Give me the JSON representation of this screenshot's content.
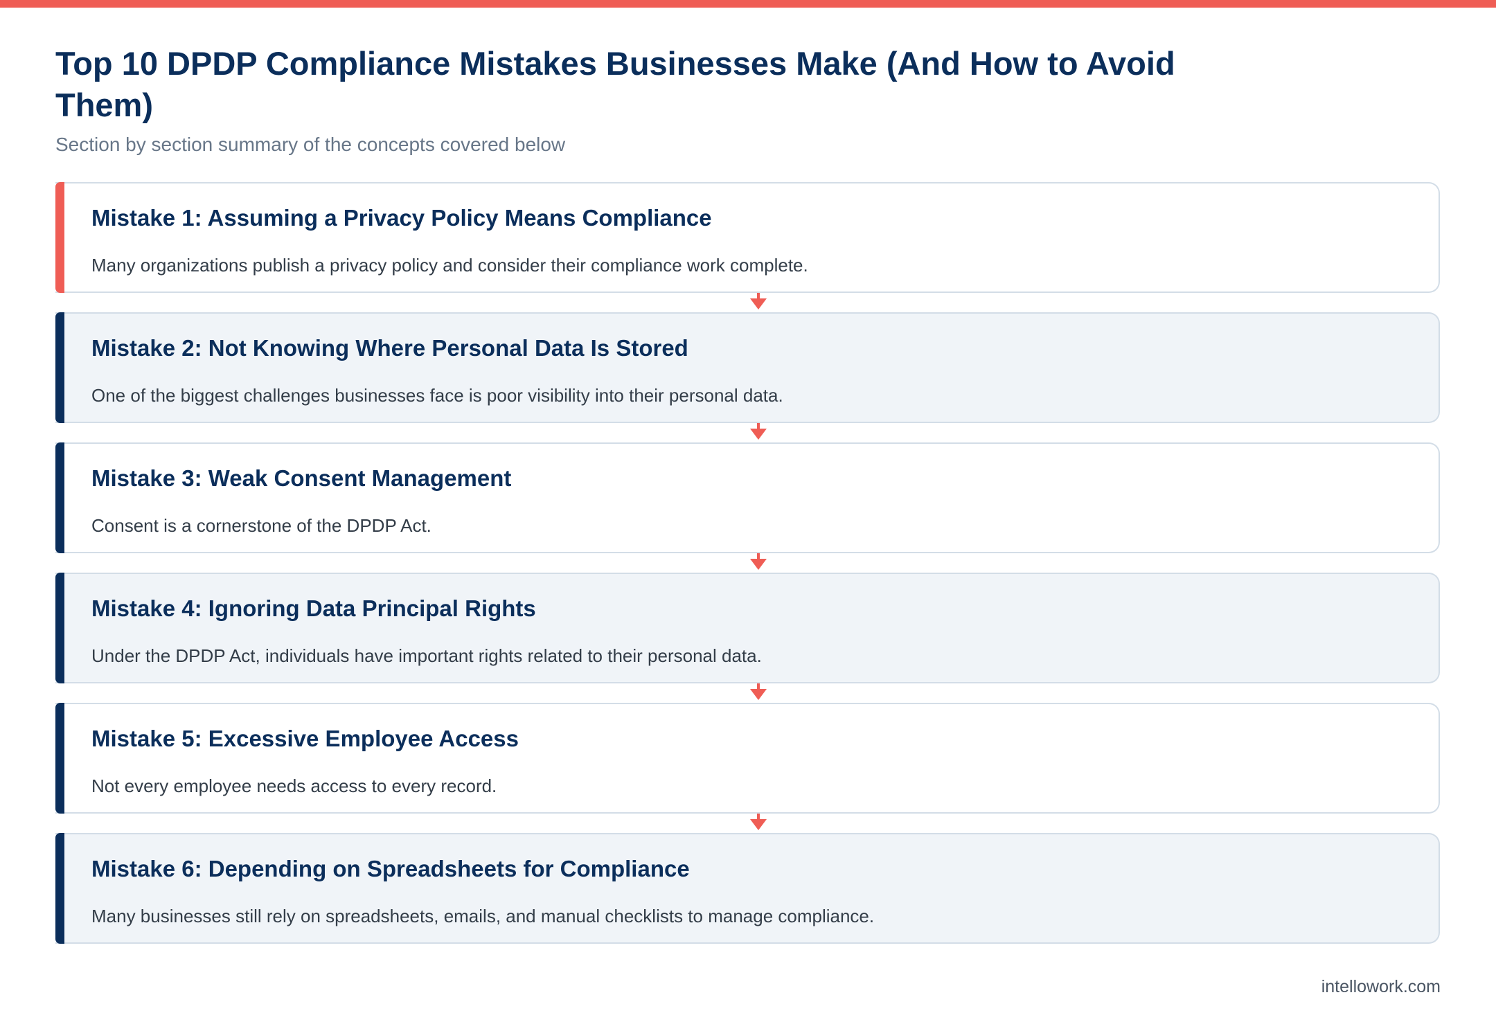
{
  "colors": {
    "accent": "#ef5d55",
    "navy": "#0b2e5b",
    "card_border": "#d3dde7",
    "card_alt_bg": "#f0f4f8"
  },
  "header": {
    "title": "Top 10 DPDP Compliance Mistakes Businesses Make (And How to Avoid Them)",
    "subtitle": "Section by section summary of the concepts covered below"
  },
  "steps": [
    {
      "title": "Mistake 1: Assuming a Privacy Policy Means Compliance",
      "description": "Many organizations publish a privacy policy and consider their compliance work complete."
    },
    {
      "title": "Mistake 2: Not Knowing Where Personal Data Is Stored",
      "description": "One of the biggest challenges businesses face is poor visibility into their personal data."
    },
    {
      "title": "Mistake 3: Weak Consent Management",
      "description": "Consent is a cornerstone of the DPDP Act."
    },
    {
      "title": "Mistake 4: Ignoring Data Principal Rights",
      "description": "Under the DPDP Act, individuals have important rights related to their personal data."
    },
    {
      "title": "Mistake 5: Excessive Employee Access",
      "description": "Not every employee needs access to every record."
    },
    {
      "title": "Mistake 6: Depending on Spreadsheets for Compliance",
      "description": "Many businesses still rely on spreadsheets, emails, and manual checklists to manage compliance."
    }
  ],
  "connector_icon": "arrow-down-icon",
  "footer": {
    "domain": "intellowork.com"
  }
}
